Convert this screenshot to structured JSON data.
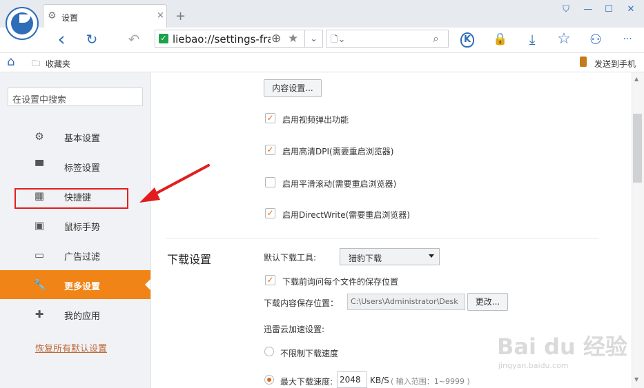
{
  "tab": {
    "title": "设置",
    "close": "×",
    "new": "+"
  },
  "window": {
    "skin": "⛉",
    "minimize": "—",
    "maximize": "☐",
    "close": "✕"
  },
  "nav": {
    "back": "‹",
    "reload": "↻",
    "undo": "↶",
    "url": "liebao://settings-frame/",
    "plus": "⊕",
    "star": "★",
    "dropdown": "⌄",
    "page": "🗋⌄",
    "search": "⌕",
    "shield": "K",
    "lock": "🔒",
    "download": "⤓",
    "fav": "☆",
    "game": "⚇",
    "more": "···"
  },
  "bookmarks": {
    "home": "⌂",
    "folder": "🗀",
    "favorites": "收藏夹",
    "send_to_phone": "发送到手机"
  },
  "sidebar": {
    "search_placeholder": "在设置中搜索",
    "items": [
      {
        "label": "基本设置",
        "icon": "⚙"
      },
      {
        "label": "标签设置",
        "icon": "▀"
      },
      {
        "label": "快捷键",
        "icon": "▦"
      },
      {
        "label": "鼠标手势",
        "icon": "▣"
      },
      {
        "label": "广告过滤",
        "icon": "▭"
      },
      {
        "label": "更多设置",
        "icon": "🔧"
      },
      {
        "label": "我的应用",
        "icon": "✚"
      }
    ],
    "active_index": 5,
    "restore": "恢复所有默认设置"
  },
  "content": {
    "content_settings_button": "内容设置...",
    "checkboxes": [
      {
        "label": "启用视频弹出功能",
        "checked": true
      },
      {
        "label": "启用高清DPI(需要重启浏览器)",
        "checked": true
      },
      {
        "label": "启用平滑滚动(需要重启浏览器)",
        "checked": false
      },
      {
        "label": "启用DirectWrite(需要重启浏览器)",
        "checked": true
      }
    ],
    "download": {
      "section_title": "下载设置",
      "default_tool_label": "默认下载工具:",
      "default_tool_value": "猎豹下载",
      "ask_location": {
        "label": "下载前询问每个文件的保存位置",
        "checked": true
      },
      "path_label": "下载内容保存位置：",
      "path_value": "C:\\Users\\Administrator\\Desk",
      "change_button": "更改...",
      "xunlei_label": "迅雷云加速设置:",
      "unlimited": "不限制下载速度",
      "max_speed_label": "最大下载速度:",
      "max_speed_value": "2048",
      "speed_unit": "KB/S",
      "range_hint": "( 输入范围：1~9999 )"
    }
  },
  "watermark": {
    "main": "Bai du 经验",
    "url": "jingyan.baidu.com"
  },
  "colors": {
    "accent": "#f08416",
    "brand": "#2e6db7",
    "annotation": "#e21d1d"
  }
}
